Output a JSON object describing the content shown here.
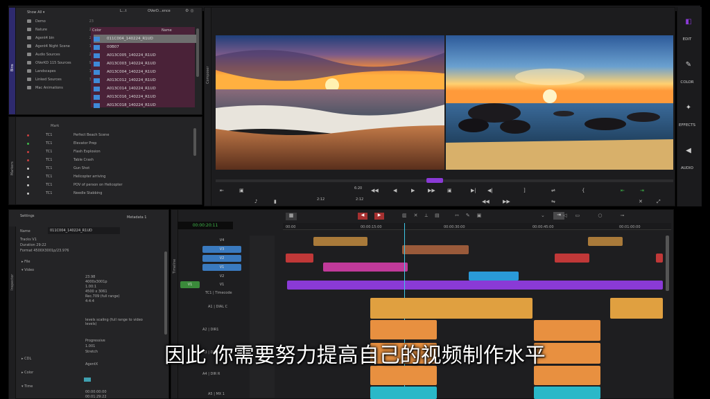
{
  "bins_header": {
    "dropdown": "Show All",
    "tab_a": "L...t",
    "tab_b": "OVerD...ence"
  },
  "bin_items": [
    {
      "label": "Demo",
      "count": "23"
    },
    {
      "label": "Nature",
      "count": "23"
    },
    {
      "label": "Agent4 bin",
      "count": "23"
    },
    {
      "label": "Agent4 Night Scene",
      "count": "14"
    },
    {
      "label": "Audio Sources",
      "count": "24"
    },
    {
      "label": "OVerKD 115 Sources",
      "count": "90"
    },
    {
      "label": "Landscapes",
      "count": "18"
    },
    {
      "label": "Linked Sources",
      "count": "33"
    },
    {
      "label": "Mac Animations",
      "count": "9"
    }
  ],
  "clip_columns": {
    "color": "Color",
    "name": "Name"
  },
  "clips": [
    "011C004_140224_R1UD",
    "00B07",
    "A013C005_140224_R1UD",
    "A013C003_140224_R1UD",
    "A013C004_140224_R1UD",
    "A013C012_140224_R1UD",
    "A013C014_140224_R1UD",
    "A013C016_140224_R1UD",
    "A013C018_140224_R1UD"
  ],
  "bins_tab": "Bins",
  "markers": {
    "tab": "Markers",
    "col_mark": "Mark",
    "items": [
      {
        "tc": "TC1",
        "name": "Perfect Beach Scene",
        "color": "#c94040"
      },
      {
        "tc": "TC1",
        "name": "Elevator Prep",
        "color": "#3fb84a"
      },
      {
        "tc": "TC1",
        "name": "Flash Explosion",
        "color": "#c94040"
      },
      {
        "tc": "TC1",
        "name": "Table Crash",
        "color": "#c94040"
      },
      {
        "tc": "TC1",
        "name": "Gun Shot",
        "color": "#cccccc"
      },
      {
        "tc": "TC1",
        "name": "Helicopter arriving",
        "color": "#cccccc"
      },
      {
        "tc": "TC1",
        "name": "POV of person on Helicopter",
        "color": "#cccccc"
      },
      {
        "tc": "TC1",
        "name": "Needle Stabbing",
        "color": "#cccccc"
      }
    ]
  },
  "composer": {
    "tab": "Composer",
    "tc_left": "2:12",
    "tc_right": "2:12",
    "tc_mid": "6:20"
  },
  "sidebar": {
    "edit": "EDIT",
    "color": "COLOR",
    "effects": "EFFECTS",
    "audio": "AUDIO"
  },
  "settings": {
    "tab": "Settings",
    "inspector_tab": "Inspector",
    "metadata": "Metadata 1",
    "name_label": "Name",
    "name_value": "011C004_140224_R1UD",
    "tracks": "Tracks  V1",
    "duration": "Duration  29:22",
    "format": "Format  4500X3001p/23.976",
    "file": "File",
    "video": "Video",
    "video_props": [
      "23.98",
      "4000x3001p",
      "1.00:1",
      "4500 x 3061",
      "Rec.709 (full range)",
      "4:4:4"
    ],
    "levels_note": "levels scaling (full range to video levels)",
    "playback": "Progressive",
    "playback2": "1.001",
    "playback3": "Stretch",
    "cdl": "CDL",
    "cdl_val": "AgentX",
    "color": "Color",
    "time": "Time",
    "time_vals": [
      "00:00:00:00",
      "00:01:29:22"
    ]
  },
  "timeline": {
    "tab": "Timeline",
    "timecode": "00:00:20:11",
    "tc_label": "TC1 | Timecode",
    "ruler": [
      "00:00",
      "00:00:15:00",
      "00:00:30:00",
      "00:00:45:00",
      "00:01:00:00"
    ],
    "tracks": [
      {
        "label": "V4"
      },
      {
        "label": "V3"
      },
      {
        "label": "V2"
      },
      {
        "label": "V1"
      }
    ],
    "v1_label": "V1",
    "audio": [
      "A1 | DIAL C",
      "A2 | DIR1",
      "A3 | DIR 2",
      "A4 | DIR R",
      "A5 | MX 1"
    ]
  },
  "subtitle": "因此 你需要努力提高自己的视频制作水平"
}
